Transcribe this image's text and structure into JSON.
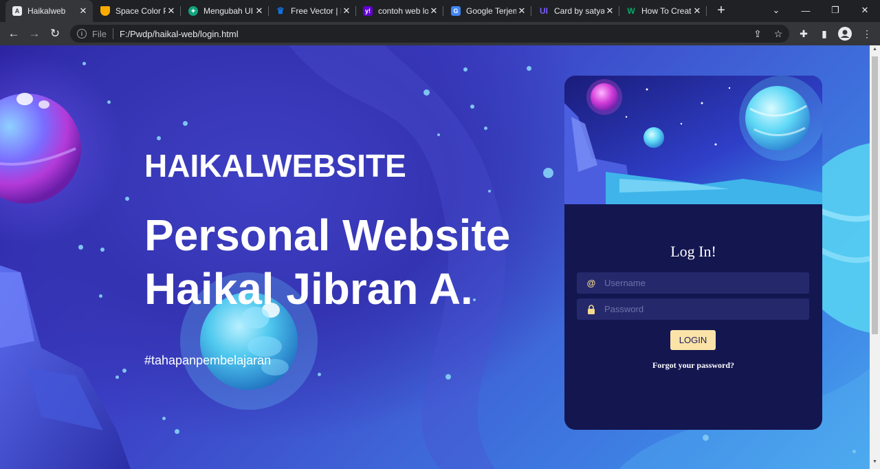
{
  "browser": {
    "tabs": [
      {
        "title": "Haikalweb",
        "active": true,
        "favicon": "page-icon",
        "color": "#5f6368"
      },
      {
        "title": "Space Color P",
        "active": false,
        "favicon": "shield-icon",
        "color": "#f9ab00"
      },
      {
        "title": "Mengubah UI",
        "active": false,
        "favicon": "chatgpt-icon",
        "color": "#10a37f"
      },
      {
        "title": "Free Vector | F",
        "active": false,
        "favicon": "freepik-icon",
        "color": "#1273eb"
      },
      {
        "title": "contoh web lo",
        "active": false,
        "favicon": "yahoo-icon",
        "color": "#6001d2"
      },
      {
        "title": "Google Terjem",
        "active": false,
        "favicon": "translate-icon",
        "color": "#4285f4"
      },
      {
        "title": "Card by satya",
        "active": false,
        "favicon": "uiverse-icon",
        "color": "#7c5cff"
      },
      {
        "title": "How To Creat",
        "active": false,
        "favicon": "w3schools-icon",
        "color": "#04aa6d"
      }
    ],
    "new_tab_glyph": "+",
    "url_scheme_label": "File",
    "url": "F:/Pwdp/haikal-web/login.html"
  },
  "hero": {
    "brand": "HAIKALWEBSITE",
    "headline_line1": "Personal Website",
    "headline_line2": "Haikal Jibran A.",
    "hashtag": "#tahapanpembelajaran"
  },
  "login": {
    "title": "Log In!",
    "username_placeholder": "Username",
    "password_placeholder": "Password",
    "button_label": "LOGIN",
    "forgot_label": "Forgot your password?"
  },
  "colors": {
    "card_bg": "#141650",
    "field_bg": "#25296b",
    "button_bg": "#fbe3a8",
    "icon_accent": "#f3d98f"
  }
}
